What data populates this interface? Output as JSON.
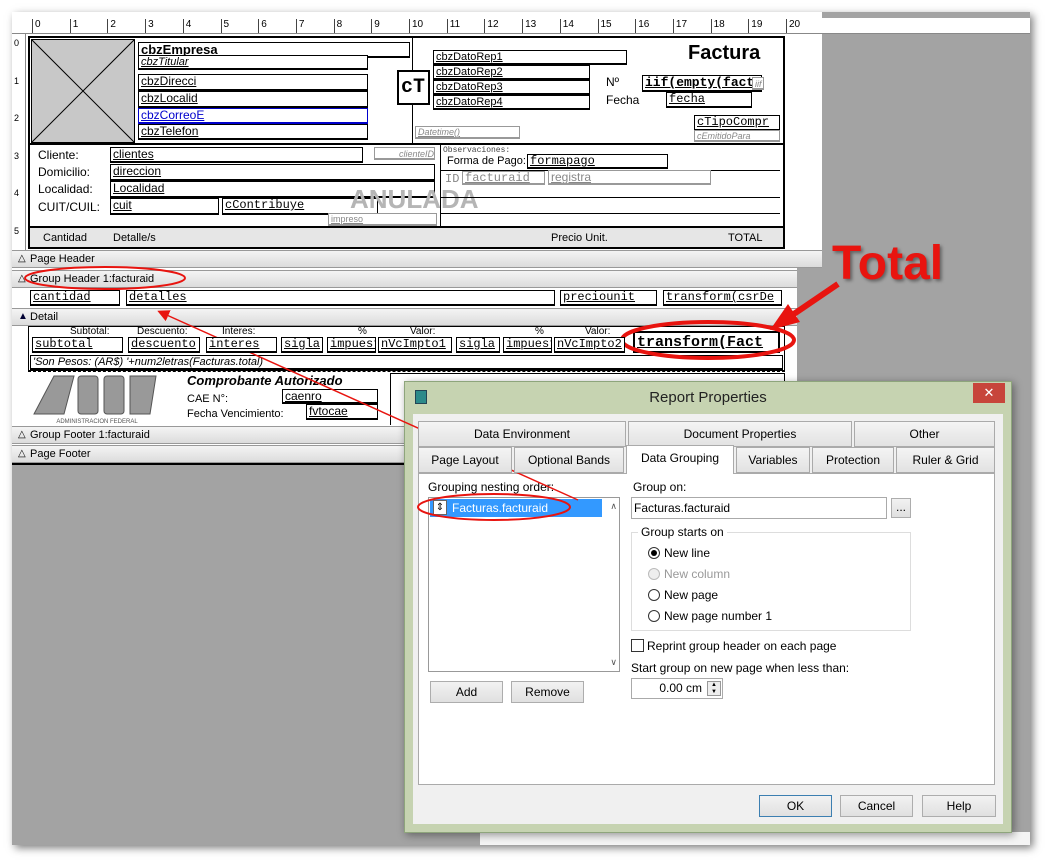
{
  "ruler": {
    "h": [
      "0",
      "1",
      "2",
      "3",
      "4",
      "5",
      "6",
      "7",
      "8",
      "9",
      "10",
      "11",
      "12",
      "13",
      "14",
      "15",
      "16",
      "17",
      "18",
      "19",
      "20"
    ],
    "v": [
      "0",
      "1",
      "2",
      "3",
      "4",
      "5"
    ]
  },
  "header": {
    "empresa": "cbzEmpresa",
    "titular": "cbzTitular",
    "direcci": "cbzDirecci",
    "localid": "cbzLocalid",
    "correo": "cbzCorreoE",
    "telefon": "cbzTelefon",
    "ct": "cT",
    "rep1": "cbzDatoRep1",
    "rep2": "cbzDatoRep2",
    "rep3": "cbzDatoRep3",
    "rep4": "cbzDatoRep4",
    "factura": "Factura",
    "nro_label": "Nº",
    "nro": "iif(empty(fact",
    "iif_small": "iif",
    "fecha_label": "Fecha",
    "fecha": "fecha",
    "tipo": "cTipoCompr",
    "emitido": "cEmitidoPara",
    "datetime": "Datetime()"
  },
  "client": {
    "cliente_label": "Cliente:",
    "domicilio_label": "Domicilio:",
    "localidad_label": "Localidad:",
    "cuit_label": "CUIT/CUIL:",
    "clientes": "clientes",
    "clienteid": "clienteID",
    "direccion": "direccion",
    "localidad": "Localidad",
    "cuit": "cuit",
    "contribuye": "cContribuye",
    "impreso": "impreso",
    "obs": "Observaciones:",
    "forma_label": "Forma de Pago:",
    "formapago": "formapago",
    "id_label": "ID",
    "facturaid": "facturaid",
    "registra": "registra",
    "watermark": "ANULADA"
  },
  "columns": [
    "Cantidad",
    "Detalle/s",
    "Precio Unit.",
    "TOTAL"
  ],
  "bands": {
    "page_header": "Page Header",
    "group_header": "Group Header 1:facturaid",
    "detail": "Detail",
    "group_footer": "Group Footer 1:facturaid",
    "page_footer": "Page Footer"
  },
  "group_row": [
    "cantidad",
    "detalles",
    "preciounit",
    "transform(csrDe"
  ],
  "detail": {
    "labels": [
      "Subtotal:",
      "Descuento:",
      "Interes:",
      "%",
      "Valor:",
      "%",
      "Valor:"
    ],
    "fields": [
      "subtotal",
      "descuento",
      "interes",
      "sigla",
      "impuest",
      "nVcImpto1",
      "sigla",
      "impuest",
      "nVcImpto2"
    ],
    "total": "transform(Fact",
    "letras": "'Son Pesos: (AR$) '+num2letras(Facturas.total)"
  },
  "footer": {
    "logo": "AFIP",
    "logo_sub": "ADMINISTRACION FEDERAL",
    "autorizado": "Comprobante Autorizado",
    "cae_label": "CAE N°:",
    "cae": "caenro",
    "vto_label": "Fecha Vencimiento:",
    "vto": "fvtocae"
  },
  "annotation": {
    "text": "Total",
    "color": "#e8140f"
  },
  "dialog": {
    "title": "Report Properties",
    "tabs_row1": [
      "Data Environment",
      "Document Properties",
      "Other"
    ],
    "tabs_row2": [
      "Page Layout",
      "Optional Bands",
      "Data Grouping",
      "Variables",
      "Protection",
      "Ruler & Grid"
    ],
    "active_tab": "Data Grouping",
    "nesting_label": "Grouping nesting order:",
    "nesting_items": [
      "Facturas.facturaid"
    ],
    "group_on_label": "Group on:",
    "group_on": "Facturas.facturaid",
    "browse": "...",
    "starts_on_label": "Group starts on",
    "options": [
      {
        "label": "New line",
        "checked": true,
        "disabled": false
      },
      {
        "label": "New column",
        "checked": false,
        "disabled": true
      },
      {
        "label": "New page",
        "checked": false,
        "disabled": false
      },
      {
        "label": "New page number 1",
        "checked": false,
        "disabled": false
      }
    ],
    "reprint_label": "Reprint group header on each page",
    "reprint_checked": false,
    "less_than_label": "Start group on new page when less than:",
    "less_than": "0.00 cm",
    "add": "Add",
    "remove": "Remove",
    "ok": "OK",
    "cancel": "Cancel",
    "help": "Help",
    "selection_color": "#3399ff"
  }
}
